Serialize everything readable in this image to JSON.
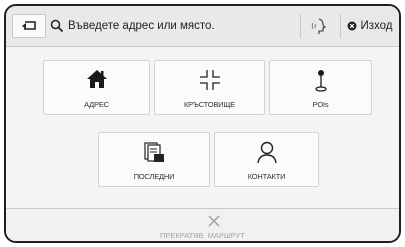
{
  "topbar": {
    "back_icon": "back-arrow-icon",
    "search_placeholder": "Въведете адрес или място.",
    "voice_icon": "voice-input-icon",
    "exit_label": "Изход"
  },
  "tiles": [
    {
      "label": "АДРЕС",
      "icon": "home-icon"
    },
    {
      "label": "КРЪСТОВИЩЕ",
      "icon": "intersection-icon"
    },
    {
      "label": "POIs",
      "icon": "poi-pin-icon"
    },
    {
      "label": "ПОСЛЕДНИ",
      "icon": "recent-icon"
    },
    {
      "label": "КОНТАКТИ",
      "icon": "contacts-icon"
    }
  ],
  "cancel": {
    "label": "ПРЕКРАТЯВ. МАРШРУТ",
    "icon": "close-icon"
  }
}
